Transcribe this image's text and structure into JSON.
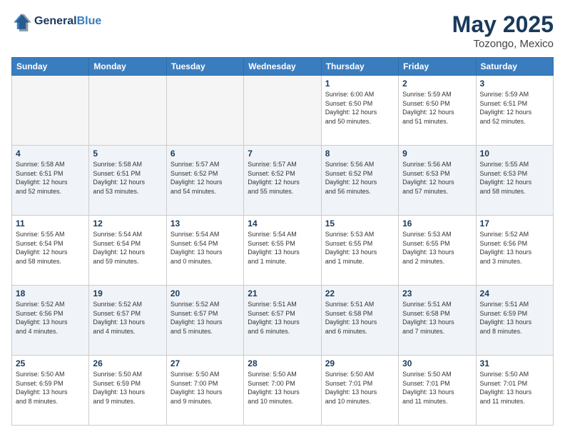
{
  "header": {
    "logo_line1": "General",
    "logo_line2": "Blue",
    "month": "May 2025",
    "location": "Tozongo, Mexico"
  },
  "weekdays": [
    "Sunday",
    "Monday",
    "Tuesday",
    "Wednesday",
    "Thursday",
    "Friday",
    "Saturday"
  ],
  "weeks": [
    [
      {
        "day": "",
        "empty": true
      },
      {
        "day": "",
        "empty": true
      },
      {
        "day": "",
        "empty": true
      },
      {
        "day": "",
        "empty": true
      },
      {
        "day": "1",
        "info": "Sunrise: 6:00 AM\nSunset: 6:50 PM\nDaylight: 12 hours\nand 50 minutes."
      },
      {
        "day": "2",
        "info": "Sunrise: 5:59 AM\nSunset: 6:50 PM\nDaylight: 12 hours\nand 51 minutes."
      },
      {
        "day": "3",
        "info": "Sunrise: 5:59 AM\nSunset: 6:51 PM\nDaylight: 12 hours\nand 52 minutes."
      }
    ],
    [
      {
        "day": "4",
        "info": "Sunrise: 5:58 AM\nSunset: 6:51 PM\nDaylight: 12 hours\nand 52 minutes."
      },
      {
        "day": "5",
        "info": "Sunrise: 5:58 AM\nSunset: 6:51 PM\nDaylight: 12 hours\nand 53 minutes."
      },
      {
        "day": "6",
        "info": "Sunrise: 5:57 AM\nSunset: 6:52 PM\nDaylight: 12 hours\nand 54 minutes."
      },
      {
        "day": "7",
        "info": "Sunrise: 5:57 AM\nSunset: 6:52 PM\nDaylight: 12 hours\nand 55 minutes."
      },
      {
        "day": "8",
        "info": "Sunrise: 5:56 AM\nSunset: 6:52 PM\nDaylight: 12 hours\nand 56 minutes."
      },
      {
        "day": "9",
        "info": "Sunrise: 5:56 AM\nSunset: 6:53 PM\nDaylight: 12 hours\nand 57 minutes."
      },
      {
        "day": "10",
        "info": "Sunrise: 5:55 AM\nSunset: 6:53 PM\nDaylight: 12 hours\nand 58 minutes."
      }
    ],
    [
      {
        "day": "11",
        "info": "Sunrise: 5:55 AM\nSunset: 6:54 PM\nDaylight: 12 hours\nand 58 minutes."
      },
      {
        "day": "12",
        "info": "Sunrise: 5:54 AM\nSunset: 6:54 PM\nDaylight: 12 hours\nand 59 minutes."
      },
      {
        "day": "13",
        "info": "Sunrise: 5:54 AM\nSunset: 6:54 PM\nDaylight: 13 hours\nand 0 minutes."
      },
      {
        "day": "14",
        "info": "Sunrise: 5:54 AM\nSunset: 6:55 PM\nDaylight: 13 hours\nand 1 minute."
      },
      {
        "day": "15",
        "info": "Sunrise: 5:53 AM\nSunset: 6:55 PM\nDaylight: 13 hours\nand 1 minute."
      },
      {
        "day": "16",
        "info": "Sunrise: 5:53 AM\nSunset: 6:55 PM\nDaylight: 13 hours\nand 2 minutes."
      },
      {
        "day": "17",
        "info": "Sunrise: 5:52 AM\nSunset: 6:56 PM\nDaylight: 13 hours\nand 3 minutes."
      }
    ],
    [
      {
        "day": "18",
        "info": "Sunrise: 5:52 AM\nSunset: 6:56 PM\nDaylight: 13 hours\nand 4 minutes."
      },
      {
        "day": "19",
        "info": "Sunrise: 5:52 AM\nSunset: 6:57 PM\nDaylight: 13 hours\nand 4 minutes."
      },
      {
        "day": "20",
        "info": "Sunrise: 5:52 AM\nSunset: 6:57 PM\nDaylight: 13 hours\nand 5 minutes."
      },
      {
        "day": "21",
        "info": "Sunrise: 5:51 AM\nSunset: 6:57 PM\nDaylight: 13 hours\nand 6 minutes."
      },
      {
        "day": "22",
        "info": "Sunrise: 5:51 AM\nSunset: 6:58 PM\nDaylight: 13 hours\nand 6 minutes."
      },
      {
        "day": "23",
        "info": "Sunrise: 5:51 AM\nSunset: 6:58 PM\nDaylight: 13 hours\nand 7 minutes."
      },
      {
        "day": "24",
        "info": "Sunrise: 5:51 AM\nSunset: 6:59 PM\nDaylight: 13 hours\nand 8 minutes."
      }
    ],
    [
      {
        "day": "25",
        "info": "Sunrise: 5:50 AM\nSunset: 6:59 PM\nDaylight: 13 hours\nand 8 minutes."
      },
      {
        "day": "26",
        "info": "Sunrise: 5:50 AM\nSunset: 6:59 PM\nDaylight: 13 hours\nand 9 minutes."
      },
      {
        "day": "27",
        "info": "Sunrise: 5:50 AM\nSunset: 7:00 PM\nDaylight: 13 hours\nand 9 minutes."
      },
      {
        "day": "28",
        "info": "Sunrise: 5:50 AM\nSunset: 7:00 PM\nDaylight: 13 hours\nand 10 minutes."
      },
      {
        "day": "29",
        "info": "Sunrise: 5:50 AM\nSunset: 7:01 PM\nDaylight: 13 hours\nand 10 minutes."
      },
      {
        "day": "30",
        "info": "Sunrise: 5:50 AM\nSunset: 7:01 PM\nDaylight: 13 hours\nand 11 minutes."
      },
      {
        "day": "31",
        "info": "Sunrise: 5:50 AM\nSunset: 7:01 PM\nDaylight: 13 hours\nand 11 minutes."
      }
    ]
  ]
}
